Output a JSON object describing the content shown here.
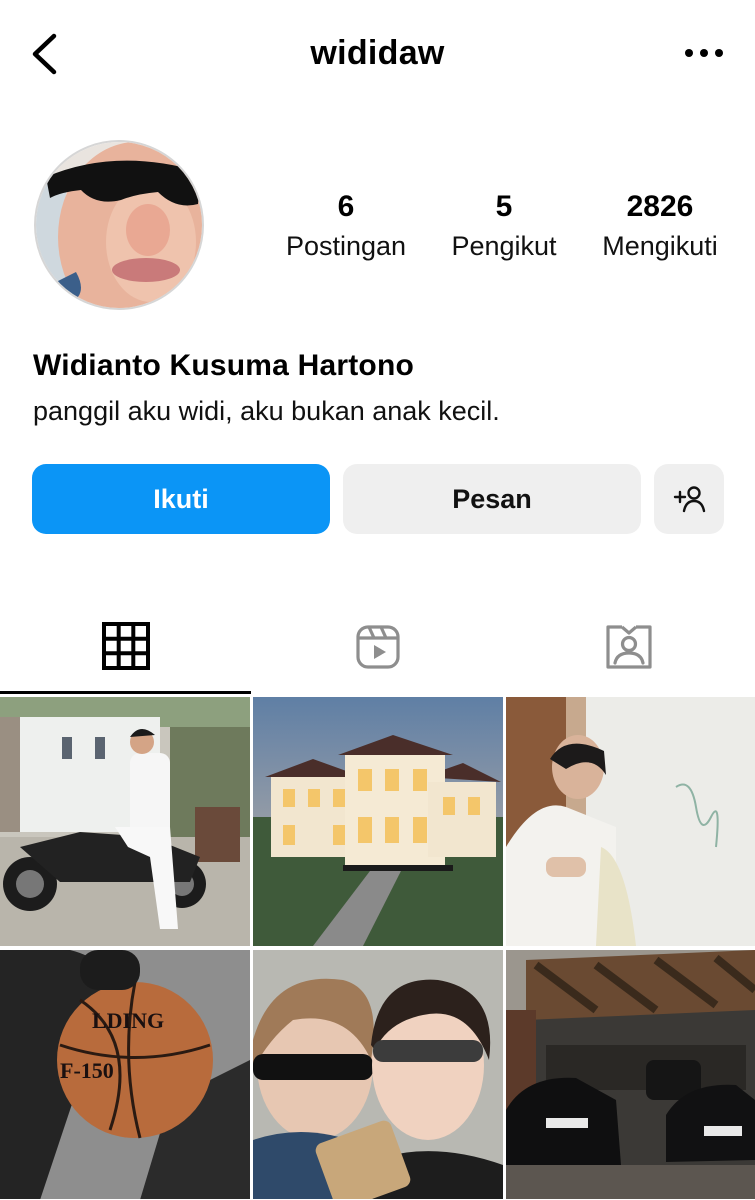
{
  "header": {
    "username": "wididaw",
    "back_icon": "chevron-left-icon",
    "more_icon": "more-horizontal-icon"
  },
  "profile": {
    "full_name": "Widianto Kusuma Hartono",
    "bio": "panggil aku widi, aku bukan anak kecil.",
    "stats": {
      "posts": {
        "count": "6",
        "label": "Postingan"
      },
      "followers": {
        "count": "5",
        "label": "Pengikut"
      },
      "following": {
        "count": "2826",
        "label": "Mengikuti"
      }
    }
  },
  "actions": {
    "follow_label": "Ikuti",
    "message_label": "Pesan",
    "suggest_icon": "add-person-icon"
  },
  "tabs": [
    {
      "name": "posts",
      "icon": "grid-icon",
      "active": true
    },
    {
      "name": "reels",
      "icon": "reels-icon",
      "active": false
    },
    {
      "name": "tagged",
      "icon": "tagged-person-icon",
      "active": false
    }
  ],
  "posts": [
    {
      "subject": "person in white suit sitting on motorbike"
    },
    {
      "subject": "illuminated mansion at dusk"
    },
    {
      "subject": "person in white shirt by whiteboard"
    },
    {
      "subject": "hand holding basketball"
    },
    {
      "subject": "two people with sunglasses selfie"
    },
    {
      "subject": "black cars parked under wooden canopy"
    }
  ],
  "colors": {
    "accent": "#0b95f6",
    "secondary_button": "#efefef",
    "text": "#000000"
  }
}
